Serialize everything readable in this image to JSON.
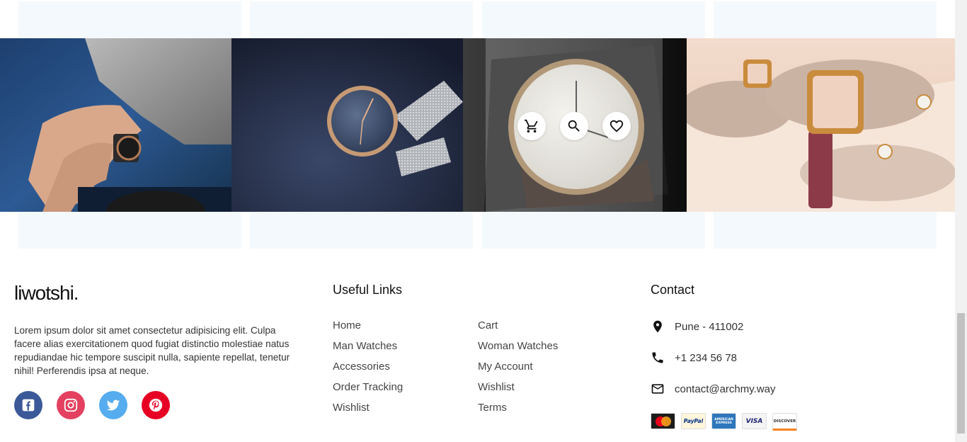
{
  "gallery": {
    "photos": [
      {
        "label": "watch-on-wrist-photo"
      },
      {
        "label": "silver-mesh-watch-photo"
      },
      {
        "label": "watch-in-box-photo"
      },
      {
        "label": "rose-gold-watches-display-photo"
      }
    ],
    "actions": {
      "cart_icon": "cart-icon",
      "search_icon": "search-icon",
      "wishlist_icon": "heart-icon"
    }
  },
  "footer": {
    "brand": "liwotshi.",
    "about": "Lorem ipsum dolor sit amet consectetur adipisicing elit. Culpa facere alias exercitationem quod fugiat distinctio molestiae natus repudiandae hic tempore suscipit nulla, sapiente repellat, tenetur nihil! Perferendis ipsa at neque.",
    "social": [
      {
        "name": "facebook",
        "color": "#3b5998"
      },
      {
        "name": "instagram",
        "color": "#e4405f"
      },
      {
        "name": "twitter",
        "color": "#55acee"
      },
      {
        "name": "pinterest",
        "color": "#e60023"
      }
    ],
    "useful_links": {
      "title": "Useful Links",
      "col1": [
        "Home",
        "Man Watches",
        "Accessories",
        "Order Tracking",
        "Wishlist"
      ],
      "col2": [
        "Cart",
        "Woman Watches",
        "My Account",
        "Wishlist",
        "Terms"
      ]
    },
    "contact": {
      "title": "Contact",
      "address": "Pune - 411002",
      "phone": "+1 234 56 78",
      "email": "contact@archmy.way"
    },
    "payments": [
      {
        "name": "MasterCard",
        "color": "#eb001b"
      },
      {
        "name": "PayPal",
        "color": "#003087"
      },
      {
        "name": "AMERICAN EXPRESS",
        "color": "#2e77bc"
      },
      {
        "name": "VISA",
        "color": "#1a1f71"
      },
      {
        "name": "DISCOVER",
        "color": "#f58220"
      }
    ]
  }
}
